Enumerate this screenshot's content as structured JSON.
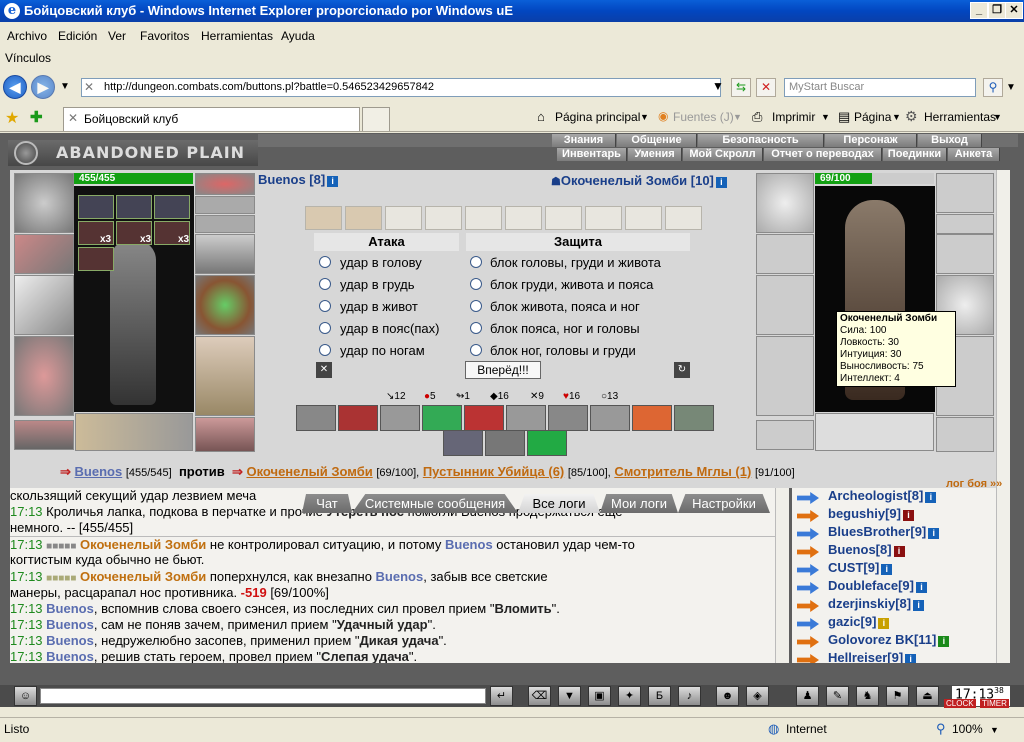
{
  "window": {
    "title": "Бойцовский клуб - Windows Internet Explorer proporcionado por Windows uE"
  },
  "menu": [
    "Archivo",
    "Edición",
    "Ver",
    "Favoritos",
    "Herramientas",
    "Ayuda"
  ],
  "links_label": "Vínculos",
  "address": {
    "url": "http://dungeon.combats.com/buttons.pl?battle=0.546523429657842"
  },
  "search": {
    "placeholder": "MyStart Buscar"
  },
  "tab": {
    "title": "Бойцовский клуб"
  },
  "commands": {
    "home": "Página principal",
    "feeds": "Fuentes (J)",
    "print": "Imprimir",
    "page": "Página",
    "tools": "Herramientas"
  },
  "game": {
    "location": "ABANDONED PLAIN",
    "nav_top": [
      "Знания",
      "Общение",
      "Безопасность",
      "Персонаж",
      "Выход"
    ],
    "nav_bottom": [
      "Инвентарь",
      "Умения",
      "Мой Скролл",
      "Отчет о переводах",
      "Поединки",
      "Анкета"
    ],
    "player": {
      "name": "Buenos [8]",
      "hp": "455/455",
      "x3a": "x3",
      "x3b": "x3",
      "x3c": "x3"
    },
    "enemy": {
      "name": "Окоченелый Зомби [10]",
      "hp": "69/100"
    },
    "attack_head": "Атака",
    "defense_head": "Защита",
    "attacks": [
      "удар в голову",
      "удар в грудь",
      "удар в живот",
      "удар в пояс(пах)",
      "удар по ногам"
    ],
    "blocks": [
      "блок головы, груди и живота",
      "блок груди, живота и пояса",
      "блок живота, пояса и ног",
      "блок пояса, ног и головы",
      "блок ног, головы и груди"
    ],
    "forward": "Вперёд!!!",
    "stats": [
      "12",
      "5",
      "1",
      "16",
      "9",
      "16",
      "13"
    ],
    "tooltip": {
      "name": "Окоченелый Зомби",
      "lines": [
        "Сила: 100",
        "Ловкость: 30",
        "Интуиция: 30",
        "Выносливость: 75",
        "Интеллект: 4"
      ]
    },
    "vs": {
      "p1": "Buenos",
      "p1hp": "[455/545]",
      "vs": "против",
      "e1": "Окоченелый Зомби",
      "e1hp": "[69/100],",
      "e2": "Пустынник Убийца (6)",
      "e2hp": "[85/100],",
      "e3": "Смотритель Мглы (1)",
      "e3hp": "[91/100]",
      "log": "лог боя »»"
    },
    "chat_tabs": [
      "Чат",
      "Системные сообщения",
      "Все логи",
      "Мои логи",
      "Настройки"
    ]
  },
  "chat": [
    {
      "t": "",
      "pre": "скользящий секущий удар лезвием меча",
      "post": ""
    },
    {
      "t": "17:13",
      "pre": "Кроличья лапка, подкова в перчатке и прочие ",
      "strong": "Утереть нос",
      "post": " помогли Buenos продержаться еще"
    },
    {
      "t": "",
      "pre": "немного. -- [455/455]",
      "post": ""
    },
    {
      "t": "17:13",
      "a": "Окоченелый Зомби",
      "mid": " не контролировал ситуацию, и потому ",
      "b": "Buenos",
      "post": " остановил удар чем-то"
    },
    {
      "t": "",
      "pre": "когтистым куда обычно не бьют.",
      "post": ""
    },
    {
      "t": "17:13",
      "a": "Окоченелый Зомби",
      "mid": " поперхнулся, как внезапно ",
      "b": "Buenos",
      "post": ", забыв все светские"
    },
    {
      "t": "",
      "pre": "манеры, расцарапал нос противника. ",
      "dmg": "-519",
      "post": " [69/100%]"
    },
    {
      "t": "17:13",
      "b": "Buenos",
      "mid": ", вспомнив слова своего сэнсея, из последних сил провел прием \"",
      "strong": "Вломить",
      "post": "\"."
    },
    {
      "t": "17:13",
      "b": "Buenos",
      "mid": ", сам не поняв зачем, применил прием \"",
      "strong": "Удачный удар",
      "post": "\"."
    },
    {
      "t": "17:13",
      "b": "Buenos",
      "mid": ", недружелюбно засопев, применил прием \"",
      "strong": "Дикая удача",
      "post": "\"."
    },
    {
      "t": "17:13",
      "b": "Buenos",
      "mid": ", решив стать героем, провел прием \"",
      "strong": "Слепая удача",
      "post": "\"."
    }
  ],
  "users": [
    {
      "name": "Archeologist",
      "lvl": "[8]"
    },
    {
      "name": "begushiy",
      "lvl": "[9]"
    },
    {
      "name": "BluesBrother",
      "lvl": "[9]"
    },
    {
      "name": "Buenos",
      "lvl": "[8]"
    },
    {
      "name": "CUST",
      "lvl": "[9]"
    },
    {
      "name": "Doubleface",
      "lvl": "[9]"
    },
    {
      "name": "dzerjinskiy",
      "lvl": "[8]"
    },
    {
      "name": "gazic",
      "lvl": "[9]"
    },
    {
      "name": "Golovorez BK",
      "lvl": "[11]"
    },
    {
      "name": "Hellreiser",
      "lvl": "[9]"
    }
  ],
  "clock": {
    "time": "17:13",
    "sec": "38",
    "clock_label": "CLOCK",
    "timer_label": "TIMER"
  },
  "status": {
    "left": "Listo",
    "zone": "Internet",
    "zoom": "100%"
  }
}
